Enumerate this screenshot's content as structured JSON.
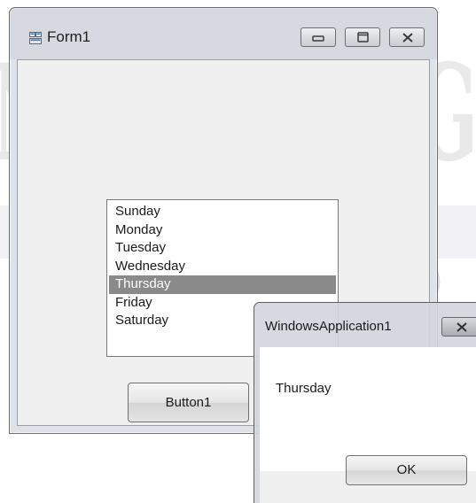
{
  "form": {
    "title": "Form1",
    "app_icon": "form-app-icon",
    "caption_buttons": [
      "minimize-icon",
      "maximize-icon",
      "close-icon"
    ]
  },
  "listbox": {
    "items": [
      "Sunday",
      "Monday",
      "Tuesday",
      "Wednesday",
      "Thursday",
      "Friday",
      "Saturday"
    ],
    "selected_index": 4,
    "selected_value": "Thursday"
  },
  "button1": {
    "label": "Button1"
  },
  "message_box": {
    "title": "WindowsApplication1",
    "message": "Thursday",
    "ok_label": "OK",
    "close_icon": "close-icon"
  },
  "colors": {
    "selection_background": "#8a8a8a",
    "window_background": "#f0f0f0"
  }
}
